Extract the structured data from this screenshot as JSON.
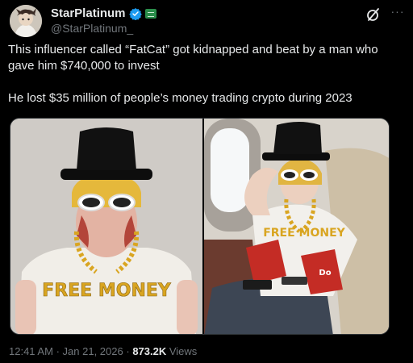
{
  "author": {
    "display_name": "StarPlatinum",
    "handle": "@StarPlatinum_",
    "verified_icon": "verified-badge-icon",
    "affiliate_icon": "affiliate-badge-icon",
    "avatar_icon": "avatar-image"
  },
  "header_actions": {
    "grok_icon": "grok-icon",
    "more_icon": "more-options-icon",
    "more_glyph": "···"
  },
  "tweet_text": {
    "line1": "This influencer called   “FatCat”  got kidnapped and beat by a man who gave him $740,000 to invest",
    "line2": "He lost $35 million of people’s money trading crypto during 2023"
  },
  "media": {
    "left_image": {
      "caption_text": "FREE MONEY",
      "background": "#cfcbc6"
    },
    "right_image": {
      "caption_text": "FREE MONEY",
      "bag_text": "Do",
      "background": "#d8d3cb"
    }
  },
  "meta": {
    "time": "12:41 AM",
    "separator": "·",
    "date": "Jan 21, 2026",
    "views_count": "873.2K",
    "views_label": "Views"
  },
  "colors": {
    "background": "#000000",
    "text": "#e7e9ea",
    "secondary": "#71767b",
    "verified": "#1d9bf0",
    "affiliate": "#2a8d4b"
  }
}
